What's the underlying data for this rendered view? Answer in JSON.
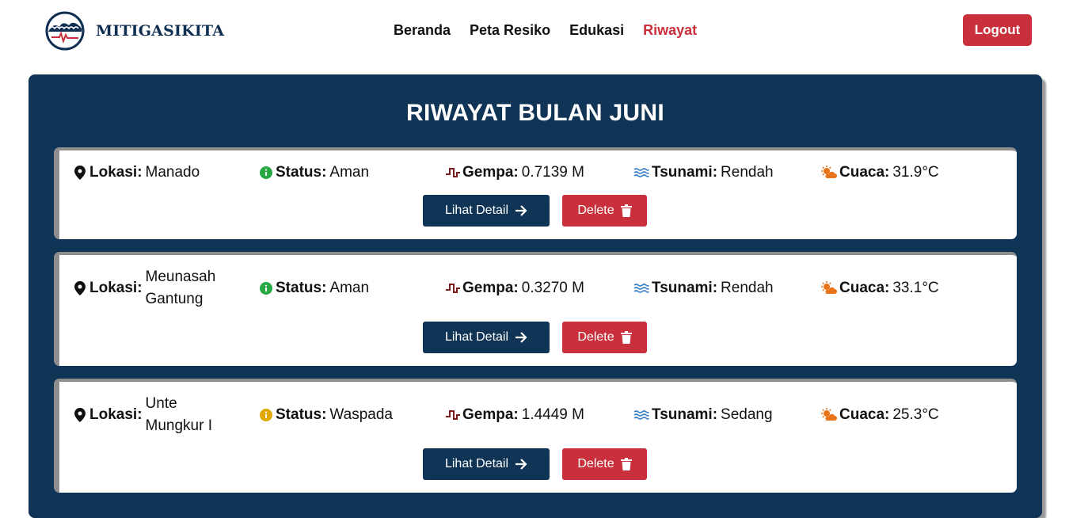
{
  "brand": {
    "name": "MITIGASIKITA"
  },
  "nav": {
    "items": [
      "Beranda",
      "Peta Resiko",
      "Edukasi",
      "Riwayat"
    ],
    "active": "Riwayat"
  },
  "logout_label": "Logout",
  "panel": {
    "title": "RIWAYAT BULAN JUNI"
  },
  "labels": {
    "lokasi": "Lokasi:",
    "status": "Status:",
    "gempa": "Gempa:",
    "tsunami": "Tsunami:",
    "cuaca": "Cuaca:"
  },
  "buttons": {
    "detail": "Lihat Detail",
    "delete": "Delete"
  },
  "colors": {
    "navy": "#0f3455",
    "red": "#c9303b",
    "status_aman": "#28a745",
    "status_waspada": "#e0a800",
    "gempa_icon": "#7a1a1a",
    "tsunami_icon": "#3b7fc4",
    "cuaca_icon": "#e8731a"
  },
  "records": [
    {
      "lokasi": "Manado",
      "status": "Aman",
      "status_level": "aman",
      "gempa": "0.7139 M",
      "tsunami": "Rendah",
      "cuaca": "31.9°C"
    },
    {
      "lokasi": "Meunasah Gantung",
      "status": "Aman",
      "status_level": "aman",
      "gempa": "0.3270 M",
      "tsunami": "Rendah",
      "cuaca": "33.1°C"
    },
    {
      "lokasi": "Unte Mungkur I",
      "status": "Waspada",
      "status_level": "waspada",
      "gempa": "1.4449 M",
      "tsunami": "Sedang",
      "cuaca": "25.3°C"
    }
  ]
}
